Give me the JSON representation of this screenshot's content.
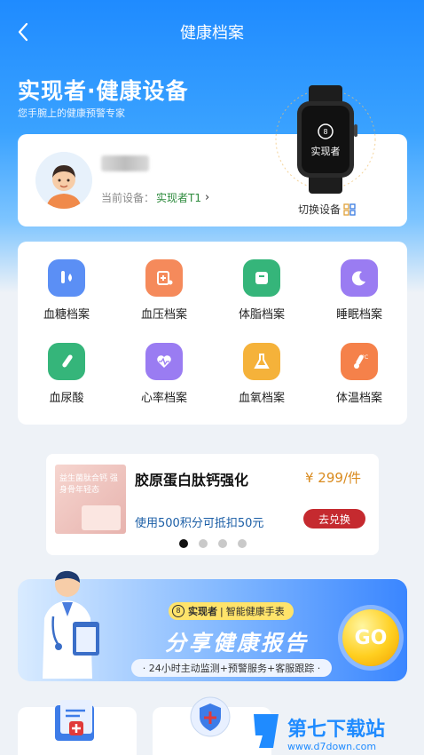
{
  "header": {
    "title": "健康档案",
    "back_icon": "back-chevron-icon"
  },
  "hero": {
    "title": "实现者·健康设备",
    "subtitle": "您手腕上的健康预警专家"
  },
  "profile": {
    "current_device_label": "当前设备：",
    "current_device_name": "实现者T1",
    "switch_device_label": "切换设备",
    "watch_brand": "实现者"
  },
  "records": [
    {
      "label": "血糖档案",
      "icon": "blood-sugar-icon",
      "color": "#5b8ff5"
    },
    {
      "label": "血压档案",
      "icon": "blood-pressure-icon",
      "color": "#f58a5b"
    },
    {
      "label": "体脂档案",
      "icon": "body-fat-icon",
      "color": "#35b57a"
    },
    {
      "label": "睡眠档案",
      "icon": "sleep-icon",
      "color": "#9a7cf2"
    },
    {
      "label": "血尿酸",
      "icon": "uric-acid-icon",
      "color": "#35b57a"
    },
    {
      "label": "心率档案",
      "icon": "heart-rate-icon",
      "color": "#9a7cf2"
    },
    {
      "label": "血氧档案",
      "icon": "blood-oxygen-icon",
      "color": "#f5b23a"
    },
    {
      "label": "体温档案",
      "icon": "body-temp-icon",
      "color": "#f5814a"
    }
  ],
  "promo": {
    "title": "胶原蛋白肽钙强化",
    "price": "¥ 299/件",
    "description": "使用500积分可抵扣50元",
    "button": "去兑换",
    "image_text": "益生菌肽合钙 强身骨年轻态"
  },
  "share": {
    "brand": "实现者",
    "brand_tag": "智能健康手表",
    "title": "分享健康报告",
    "subtitle": "· 24小时主动监测+预警服务+客服跟踪 ·",
    "go": "GO"
  },
  "watermark": {
    "name": "第七下载站",
    "url": "www.d7down.com"
  },
  "colors": {
    "accent": "#1f8bff",
    "price": "#d98a1d",
    "button_red": "#c52a2f",
    "device_green": "#2c8a3c"
  }
}
